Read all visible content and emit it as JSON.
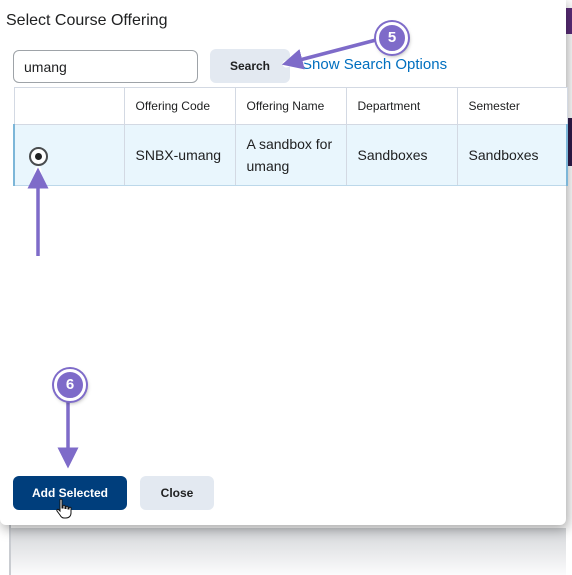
{
  "dialog": {
    "title": "Select Course Offering"
  },
  "search": {
    "value": "umang",
    "button_label": "Search",
    "show_options_label": "Show Search Options"
  },
  "table": {
    "headers": [
      "",
      "Offering Code",
      "Offering Name",
      "Department",
      "Semester"
    ],
    "rows": [
      {
        "selected": true,
        "code": "SNBX-umang",
        "name": "A sandbox for umang",
        "department": "Sandboxes",
        "semester": "Sandboxes"
      }
    ]
  },
  "footer": {
    "add_selected_label": "Add Selected",
    "close_label": "Close"
  },
  "annotations": {
    "step_search": "5",
    "step_add": "6",
    "color": "#7e6bc9"
  },
  "icons": {
    "radio": "radio-selected-icon",
    "cursor": "hand-pointer-icon"
  },
  "colors": {
    "primary_button": "#003e7c",
    "secondary_button": "#e3e9f1",
    "link": "#006fbf",
    "selected_row": "#e9f6fd"
  }
}
